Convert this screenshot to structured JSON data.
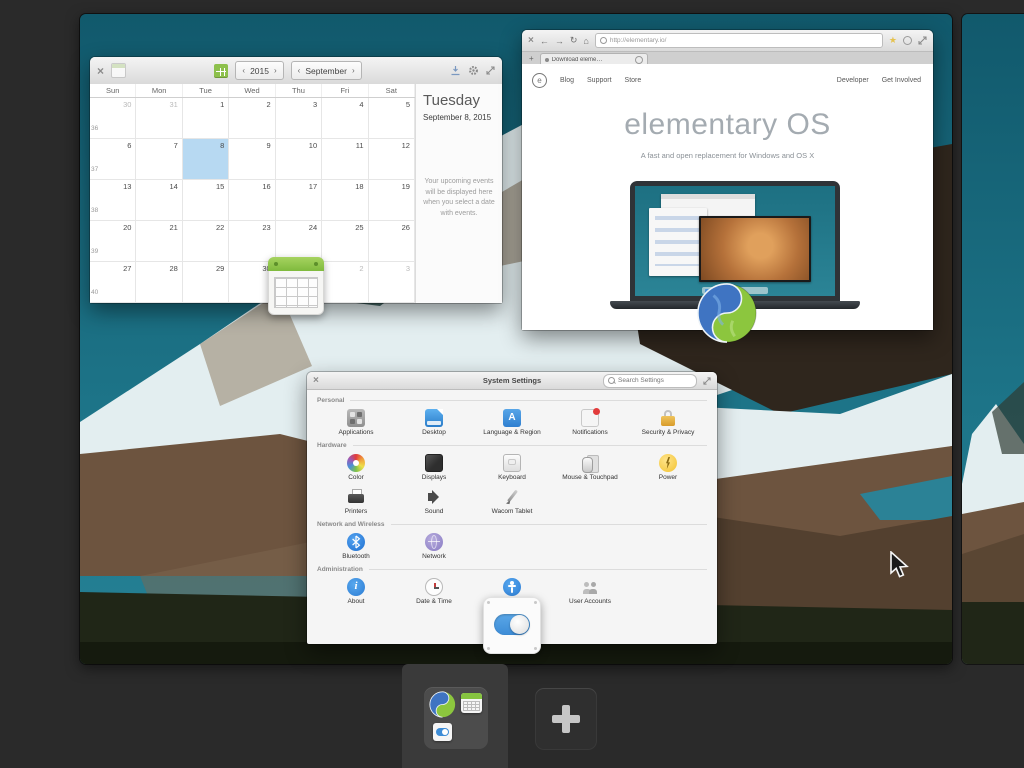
{
  "colors": {
    "accent_blue": "#3d8cd6",
    "selection_blue": "#b7d9f2",
    "wallpaper_sky": "#1a7084",
    "overview_background": "#2a2a2a",
    "calendar_today_green": "#86c440"
  },
  "calendar": {
    "titlebar": {
      "close": "×",
      "prev": "‹",
      "next": "›",
      "year": "2015",
      "month": "September"
    },
    "day_headers": [
      "Sun",
      "Mon",
      "Tue",
      "Wed",
      "Thu",
      "Fri",
      "Sat"
    ],
    "week_numbers": [
      "36",
      "37",
      "38",
      "39",
      "40"
    ],
    "weeks": [
      [
        "30",
        "31",
        "1",
        "2",
        "3",
        "4",
        "5"
      ],
      [
        "6",
        "7",
        "8",
        "9",
        "10",
        "11",
        "12"
      ],
      [
        "13",
        "14",
        "15",
        "16",
        "17",
        "18",
        "19"
      ],
      [
        "20",
        "21",
        "22",
        "23",
        "24",
        "25",
        "26"
      ],
      [
        "27",
        "28",
        "29",
        "30",
        "1",
        "2",
        "3"
      ]
    ],
    "selected_day": "8",
    "sidebar": {
      "weekday": "Tuesday",
      "date": "September 8, 2015",
      "empty_message": "Your upcoming events will be displayed here when you select a date with events."
    }
  },
  "browser": {
    "titlebar": {
      "close": "×",
      "back": "←",
      "forward": "→",
      "reload": "↻",
      "home": "⌂"
    },
    "url": "http://elementary.io/",
    "tabs": {
      "new_tab": "+",
      "active_title": "Download eleme…"
    },
    "site": {
      "logo": "e",
      "nav_left": [
        "Blog",
        "Support",
        "Store"
      ],
      "nav_right": [
        "Developer",
        "Get Involved"
      ],
      "hero_title": "elementary OS",
      "hero_subtitle": "A fast and open replacement for Windows and OS X"
    }
  },
  "settings": {
    "titlebar": {
      "close": "×",
      "title": "System Settings"
    },
    "search_placeholder": "Search Settings",
    "sections": [
      {
        "label": "Personal",
        "items": [
          {
            "label": "Applications",
            "icon": "applications-icon"
          },
          {
            "label": "Desktop",
            "icon": "desktop-icon"
          },
          {
            "label": "Language & Region",
            "icon": "language-region-icon"
          },
          {
            "label": "Notifications",
            "icon": "notifications-icon"
          },
          {
            "label": "Security & Privacy",
            "icon": "security-privacy-icon"
          }
        ]
      },
      {
        "label": "Hardware",
        "items": [
          {
            "label": "Color",
            "icon": "color-icon"
          },
          {
            "label": "Displays",
            "icon": "displays-icon"
          },
          {
            "label": "Keyboard",
            "icon": "keyboard-icon"
          },
          {
            "label": "Mouse & Touchpad",
            "icon": "mouse-touchpad-icon"
          },
          {
            "label": "Power",
            "icon": "power-icon"
          },
          {
            "label": "Printers",
            "icon": "printers-icon"
          },
          {
            "label": "Sound",
            "icon": "sound-icon"
          },
          {
            "label": "Wacom Tablet",
            "icon": "wacom-tablet-icon"
          }
        ]
      },
      {
        "label": "Network and Wireless",
        "items": [
          {
            "label": "Bluetooth",
            "icon": "bluetooth-icon"
          },
          {
            "label": "Network",
            "icon": "network-icon"
          }
        ]
      },
      {
        "label": "Administration",
        "items": [
          {
            "label": "About",
            "icon": "about-icon"
          },
          {
            "label": "Date & Time",
            "icon": "date-time-icon"
          },
          {
            "label": "",
            "icon": "universal-access-icon"
          },
          {
            "label": "User Accounts",
            "icon": "user-accounts-icon"
          }
        ]
      }
    ]
  },
  "overview_bar": {
    "add_workspace": "+"
  }
}
